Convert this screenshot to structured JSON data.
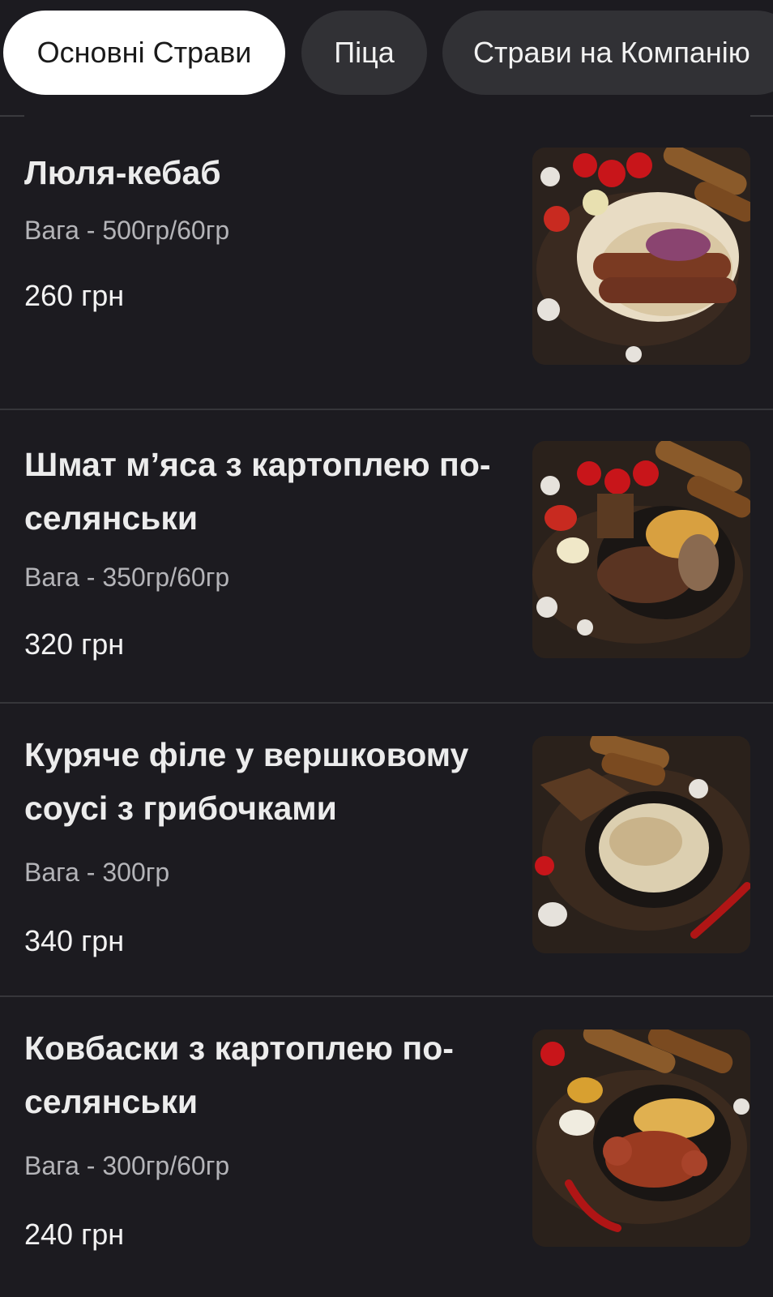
{
  "tabs": [
    {
      "label": "Основні Страви",
      "active": true
    },
    {
      "label": "Піца",
      "active": false
    },
    {
      "label": "Страви на Компанію",
      "active": false
    }
  ],
  "items": [
    {
      "name": "Люля-кебаб",
      "weight": "Вага - 500гр/60гр",
      "price": "260 грн",
      "photo": "lula-kebab-photo"
    },
    {
      "name": "Шмат м’яса з картоплею по-селянськи",
      "weight": "Вага - 350гр/60гр",
      "price": "320 грн",
      "photo": "steak-potatoes-photo"
    },
    {
      "name": "Куряче філе у вершковому соусі з грибочками",
      "weight": "Вага - 300гр",
      "price": "340 грн",
      "photo": "chicken-cream-sauce-photo"
    },
    {
      "name": "Ковбаски з картоплею по-селянськи",
      "weight": "Вага - 300гр/60гр",
      "price": "240 грн",
      "photo": "sausages-potatoes-photo"
    }
  ],
  "colors": {
    "background": "#1c1b20",
    "tab_active_bg": "#ffffff",
    "tab_inactive_bg": "#313135",
    "weight_text": "#b4b4b8"
  }
}
